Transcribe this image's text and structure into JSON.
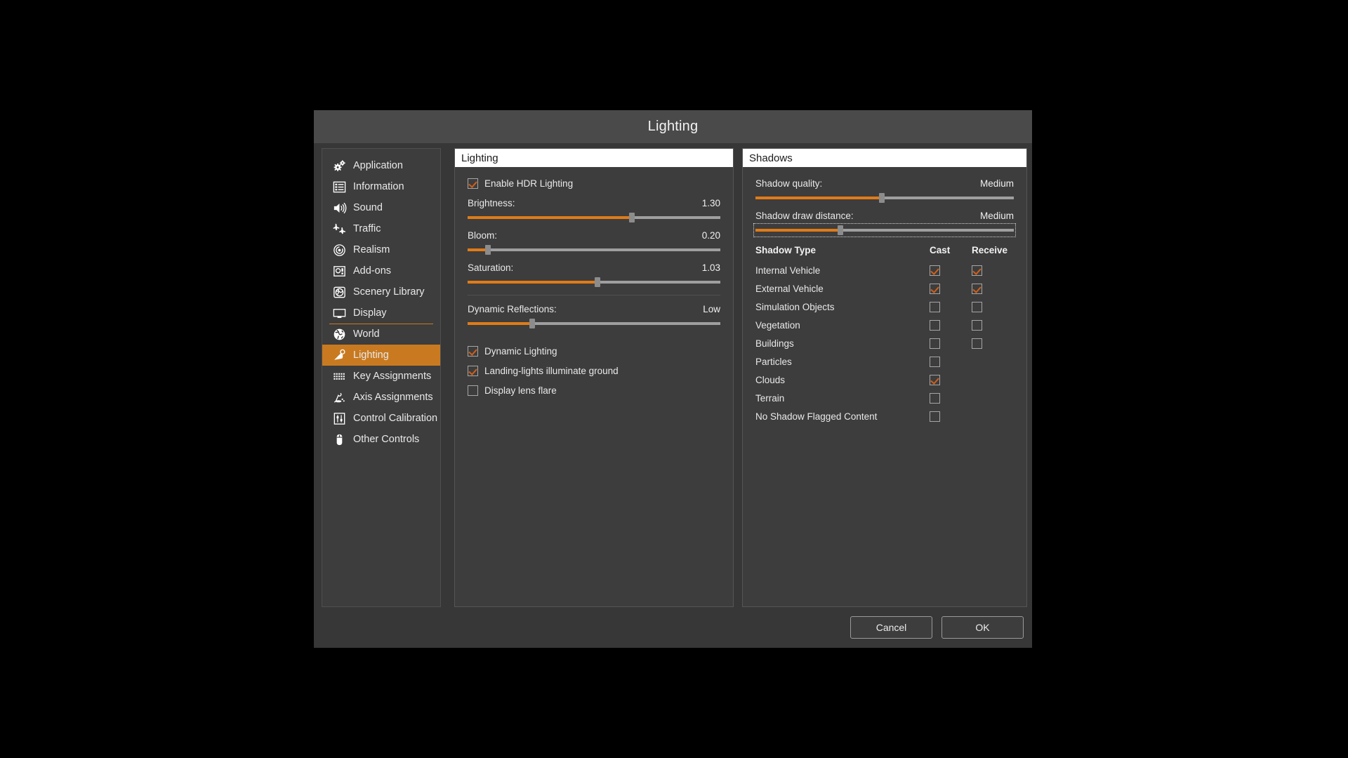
{
  "window": {
    "title": "Lighting"
  },
  "sidebar": {
    "items": [
      {
        "label": "Application",
        "icon": "gears-icon",
        "selected": false,
        "separator_after": false
      },
      {
        "label": "Information",
        "icon": "list-info-icon",
        "selected": false,
        "separator_after": false
      },
      {
        "label": "Sound",
        "icon": "speaker-icon",
        "selected": false,
        "separator_after": false
      },
      {
        "label": "Traffic",
        "icon": "aircraft-traffic-icon",
        "selected": false,
        "separator_after": false
      },
      {
        "label": "Realism",
        "icon": "gauge-dial-icon",
        "selected": false,
        "separator_after": false
      },
      {
        "label": "Add-ons",
        "icon": "addons-box-icon",
        "selected": false,
        "separator_after": false
      },
      {
        "label": "Scenery Library",
        "icon": "scenery-globe-icon",
        "selected": false,
        "separator_after": false
      },
      {
        "label": "Display",
        "icon": "monitor-icon",
        "selected": false,
        "separator_after": true
      },
      {
        "label": "World",
        "icon": "globe-icon",
        "selected": false,
        "separator_after": false
      },
      {
        "label": "Lighting",
        "icon": "lighting-beam-icon",
        "selected": true,
        "separator_after": false
      },
      {
        "label": "Key Assignments",
        "icon": "keyboard-icon",
        "selected": false,
        "separator_after": false
      },
      {
        "label": "Axis Assignments",
        "icon": "joystick-icon",
        "selected": false,
        "separator_after": false
      },
      {
        "label": "Control Calibration",
        "icon": "sliders-icon",
        "selected": false,
        "separator_after": false
      },
      {
        "label": "Other Controls",
        "icon": "mouse-icon",
        "selected": false,
        "separator_after": false
      }
    ]
  },
  "lighting_panel": {
    "header": "Lighting",
    "hdr_checkbox": {
      "label": "Enable HDR Lighting",
      "checked": true
    },
    "sliders": [
      {
        "label": "Brightness:",
        "value": "1.30",
        "fill_pct": 65,
        "focused": false
      },
      {
        "label": "Bloom:",
        "value": "0.20",
        "fill_pct": 8,
        "focused": false
      },
      {
        "label": "Saturation:",
        "value": "1.03",
        "fill_pct": 51.5,
        "focused": false
      }
    ],
    "reflections_slider": {
      "label": "Dynamic Reflections:",
      "value": "Low",
      "fill_pct": 25.5,
      "focused": false
    },
    "checkboxes": [
      {
        "label": "Dynamic Lighting",
        "checked": true
      },
      {
        "label": "Landing-lights illuminate ground",
        "checked": true
      },
      {
        "label": "Display lens flare",
        "checked": false
      }
    ]
  },
  "shadows_panel": {
    "header": "Shadows",
    "sliders": [
      {
        "label": "Shadow quality:",
        "value": "Medium",
        "fill_pct": 49,
        "focused": false
      },
      {
        "label": "Shadow draw distance:",
        "value": "Medium",
        "fill_pct": 33,
        "focused": true
      }
    ],
    "table": {
      "columns": [
        "Shadow Type",
        "Cast",
        "Receive"
      ],
      "rows": [
        {
          "type": "Internal Vehicle",
          "cast": true,
          "cast_present": true,
          "receive": true,
          "receive_present": true
        },
        {
          "type": "External Vehicle",
          "cast": true,
          "cast_present": true,
          "receive": true,
          "receive_present": true
        },
        {
          "type": "Simulation Objects",
          "cast": false,
          "cast_present": true,
          "receive": false,
          "receive_present": true
        },
        {
          "type": "Vegetation",
          "cast": false,
          "cast_present": true,
          "receive": false,
          "receive_present": true
        },
        {
          "type": "Buildings",
          "cast": false,
          "cast_present": true,
          "receive": false,
          "receive_present": true
        },
        {
          "type": "Particles",
          "cast": false,
          "cast_present": true,
          "receive": false,
          "receive_present": false
        },
        {
          "type": "Clouds",
          "cast": true,
          "cast_present": true,
          "receive": false,
          "receive_present": false
        },
        {
          "type": "Terrain",
          "cast": false,
          "cast_present": true,
          "receive": false,
          "receive_present": false
        },
        {
          "type": "No Shadow Flagged Content",
          "cast": false,
          "cast_present": true,
          "receive": false,
          "receive_present": false
        }
      ]
    }
  },
  "footer": {
    "cancel_label": "Cancel",
    "ok_label": "OK"
  },
  "colors": {
    "accent": "#d2601a",
    "accent_fill": "#e07b18",
    "selected_nav": "#c97a20",
    "panel_bg": "#3d3d3d",
    "dialog_bg": "#373737",
    "titlebar_bg": "#4a4a4a"
  }
}
